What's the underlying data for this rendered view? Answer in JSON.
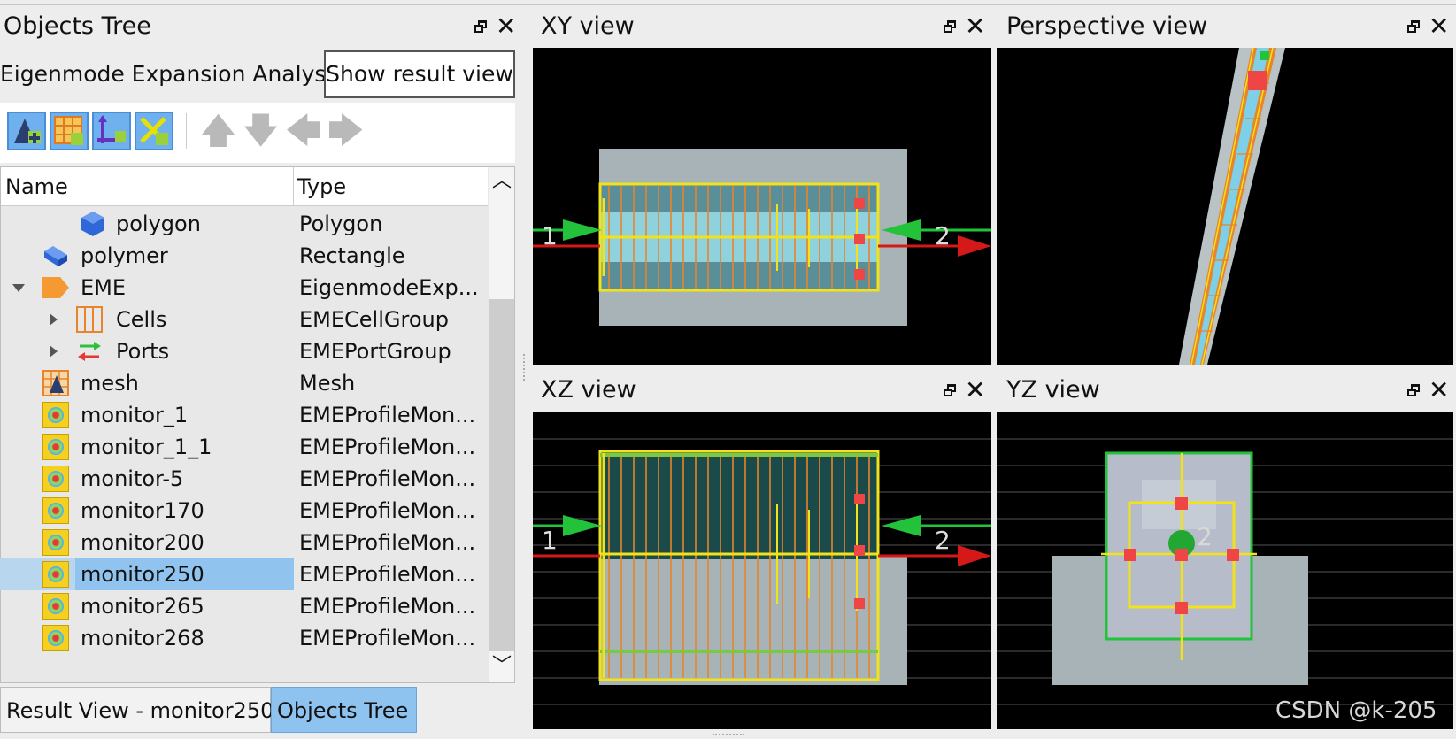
{
  "objects_tree": {
    "title": "Objects Tree",
    "analysis_label": "Eigenmode Expansion Analysis",
    "show_result_button": "Show result view",
    "columns": {
      "name": "Name",
      "type": "Type"
    },
    "rows": [
      {
        "name": "polygon",
        "type": "Polygon"
      },
      {
        "name": "polymer",
        "type": "Rectangle"
      },
      {
        "name": "EME",
        "type": "EigenmodeExp..."
      },
      {
        "name": "Cells",
        "type": "EMECellGroup"
      },
      {
        "name": "Ports",
        "type": "EMEPortGroup"
      },
      {
        "name": "mesh",
        "type": "Mesh"
      },
      {
        "name": "monitor_1",
        "type": "EMEProfileMon..."
      },
      {
        "name": "monitor_1_1",
        "type": "EMEProfileMon..."
      },
      {
        "name": "monitor-5",
        "type": "EMEProfileMon..."
      },
      {
        "name": "monitor170",
        "type": "EMEProfileMon..."
      },
      {
        "name": "monitor200",
        "type": "EMEProfileMon..."
      },
      {
        "name": "monitor250",
        "type": "EMEProfileMon..."
      },
      {
        "name": "monitor265",
        "type": "EMEProfileMon..."
      },
      {
        "name": "monitor268",
        "type": "EMEProfileMon..."
      }
    ],
    "selected_row": "monitor250",
    "toolbar_icons": [
      "add-geometry-icon",
      "add-mesh-icon",
      "add-port-icon",
      "add-monitor-icon",
      "move-up-icon",
      "move-down-icon",
      "move-left-icon",
      "move-right-icon"
    ]
  },
  "tabs": {
    "result_view": "Result View - monitor250",
    "objects_tree": "Objects Tree"
  },
  "views": {
    "xy": {
      "title": "XY view",
      "port1": "1",
      "port2": "2"
    },
    "perspective": {
      "title": "Perspective view"
    },
    "xz": {
      "title": "XZ view",
      "port1": "1",
      "port2": "2"
    },
    "yz": {
      "title": "YZ view",
      "port_label": "2"
    }
  },
  "watermark": "CSDN @k-205",
  "colors": {
    "selection": "#90c4ee",
    "active_tab": "#8ec2ef",
    "port_green": "#22c33a",
    "port_red": "#d51919",
    "monitor_red": "#f04545",
    "outline_yellow": "#f5e21a"
  }
}
